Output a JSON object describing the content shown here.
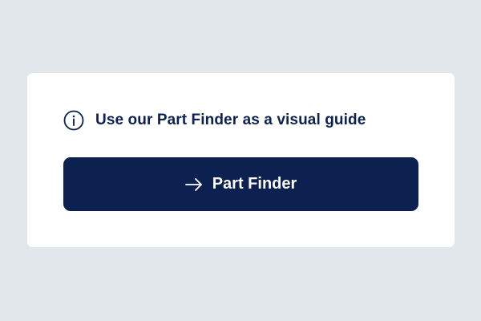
{
  "info": {
    "icon": "info-circle-icon",
    "text": "Use our Part Finder as a visual guide"
  },
  "cta": {
    "icon": "arrow-right-icon",
    "label": "Part Finder"
  },
  "colors": {
    "background": "#e1e7ea",
    "card": "#ffffff",
    "accent": "#0c2150",
    "text": "#0d2150"
  }
}
